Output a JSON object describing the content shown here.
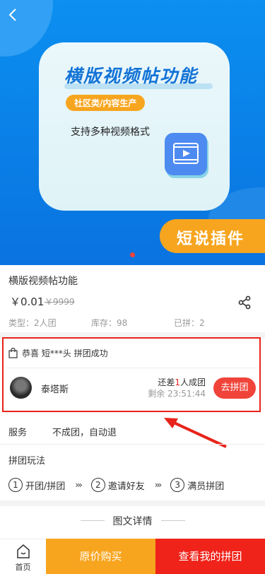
{
  "banner": {
    "card_title": "横版视频帖功能",
    "card_tag": "社区类/内容生产",
    "card_subtitle": "支持多种视频格式",
    "brand": "短说插件",
    "icon_back": "chevron-left-icon",
    "icon_video": "video-icon"
  },
  "product": {
    "title": "横版视频帖功能",
    "price": "￥0.01",
    "old_price": "￥9999",
    "type": "类型：2人团",
    "stock": "库存：98",
    "sold": "已拼：2",
    "share_icon": "share-icon"
  },
  "group": {
    "notice": "恭喜 短***头 拼团成功",
    "member_name": "泰塔斯",
    "need_prefix": "还差",
    "need_count": "1",
    "need_suffix": "人成团",
    "remain": "剩余 23:51:44",
    "join_label": "去拼团"
  },
  "service": {
    "label": "服务",
    "value": "不成团，自动退"
  },
  "play": {
    "title": "拼团玩法",
    "steps": [
      {
        "num": "1",
        "label": "开团/拼团"
      },
      {
        "num": "2",
        "label": "邀请好友"
      },
      {
        "num": "3",
        "label": "满员拼团"
      }
    ],
    "arrow": "›››"
  },
  "detail": {
    "title": "图文详情"
  },
  "bottom": {
    "home_label": "首页",
    "buy_label": "原价购买",
    "mine_label": "查看我的拼团"
  },
  "colors": {
    "accent_red": "#f0443a",
    "accent_orange": "#f7a51f",
    "banner_blue": "#0b8ff0"
  }
}
